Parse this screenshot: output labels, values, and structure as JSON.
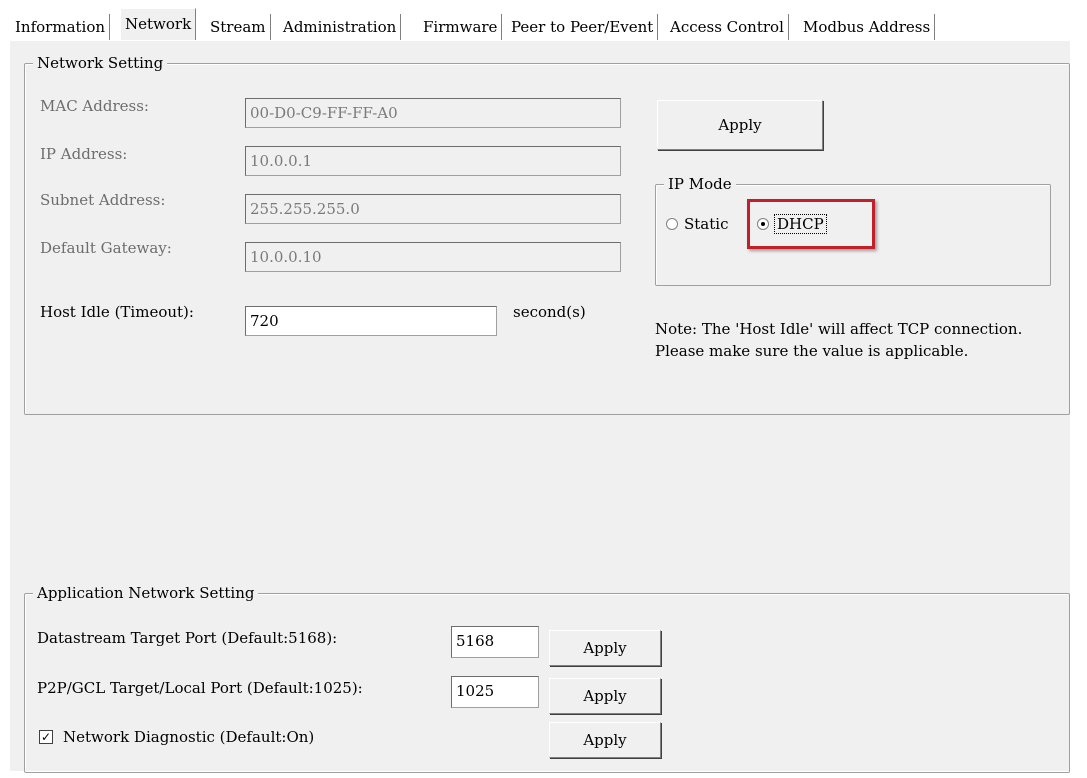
{
  "tabs": [
    {
      "label": "Information",
      "active": false
    },
    {
      "label": "Network",
      "active": true
    },
    {
      "label": "Stream",
      "active": false
    },
    {
      "label": "Administration",
      "active": false
    },
    {
      "label": "Firmware",
      "active": false
    },
    {
      "label": "Peer to Peer/Event",
      "active": false
    },
    {
      "label": "Access Control",
      "active": false
    },
    {
      "label": "Modbus Address",
      "active": false
    }
  ],
  "network_setting": {
    "title": "Network Setting",
    "mac_label": "MAC Address:",
    "mac_value": "00-D0-C9-FF-FF-A0",
    "ip_label": "IP Address:",
    "ip_value": "10.0.0.1",
    "subnet_label": "Subnet Address:",
    "subnet_value": "255.255.255.0",
    "gateway_label": "Default Gateway:",
    "gateway_value": "10.0.0.10",
    "host_idle_label": "Host Idle (Timeout):",
    "host_idle_value": "720",
    "host_idle_unit": "second(s)",
    "apply_label": "Apply",
    "ip_mode": {
      "title": "IP Mode",
      "static_label": "Static",
      "dhcp_label": "DHCP",
      "selected": "DHCP"
    },
    "note_line1": "Note:   The 'Host Idle' will affect TCP connection.",
    "note_line2": "Please make sure the value is applicable."
  },
  "application_network": {
    "title": "Application Network Setting",
    "datastream_label": "Datastream Target Port (Default:5168):",
    "datastream_value": "5168",
    "p2p_label": "P2P/GCL Target/Local Port (Default:1025):",
    "p2p_value": "1025",
    "diagnostic_label": "Network Diagnostic (Default:On)",
    "diagnostic_checked": true,
    "apply_label": "Apply"
  },
  "colors": {
    "highlight": "#c0202a",
    "panel": "#f0f0f0"
  }
}
